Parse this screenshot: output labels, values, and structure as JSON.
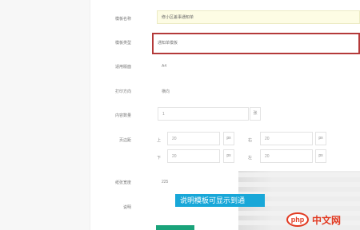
{
  "form": {
    "rows": [
      {
        "label": "模板名称",
        "value": "修小区差事通知单"
      },
      {
        "label": "模板类型",
        "value": "通知单模板"
      },
      {
        "label": "适用版面",
        "value": "A4"
      },
      {
        "label": "打印方向",
        "value": "横向"
      },
      {
        "label": "内容数量",
        "value": "1"
      },
      {
        "label": "页边距",
        "value": ""
      },
      {
        "label": "纸张宽度",
        "value": "225"
      },
      {
        "label": "说明",
        "value": ""
      }
    ],
    "margins": {
      "top_label": "上",
      "top_value": "20",
      "top_unit": "px",
      "right_label": "右",
      "right_value": "20",
      "right_unit": "px",
      "bottom_label": "下",
      "bottom_value": "20",
      "bottom_unit": "px",
      "left_label": "左",
      "left_value": "20",
      "left_unit": "px"
    },
    "count_suffix": "张"
  },
  "banner_text": "说明模板可显示到通",
  "logo": {
    "mark": "php",
    "text": "中文网"
  },
  "colors": {
    "highlight_border": "#b43a3a",
    "banner": "#18a7d8",
    "accent": "#1aa37a"
  }
}
